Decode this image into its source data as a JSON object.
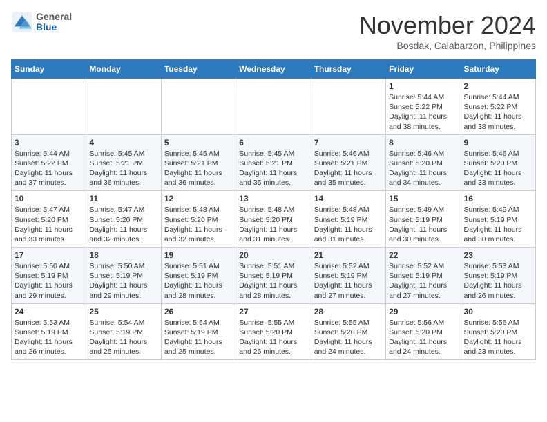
{
  "header": {
    "logo": {
      "general": "General",
      "blue": "Blue"
    },
    "title": "November 2024",
    "location": "Bosdak, Calabarzon, Philippines"
  },
  "days_of_week": [
    "Sunday",
    "Monday",
    "Tuesday",
    "Wednesday",
    "Thursday",
    "Friday",
    "Saturday"
  ],
  "weeks": [
    [
      null,
      null,
      null,
      null,
      null,
      {
        "day": 1,
        "sunrise": "5:44 AM",
        "sunset": "5:22 PM",
        "daylight": "11 hours and 38 minutes."
      },
      {
        "day": 2,
        "sunrise": "5:44 AM",
        "sunset": "5:22 PM",
        "daylight": "11 hours and 38 minutes."
      }
    ],
    [
      {
        "day": 3,
        "sunrise": "5:44 AM",
        "sunset": "5:22 PM",
        "daylight": "11 hours and 37 minutes."
      },
      {
        "day": 4,
        "sunrise": "5:45 AM",
        "sunset": "5:21 PM",
        "daylight": "11 hours and 36 minutes."
      },
      {
        "day": 5,
        "sunrise": "5:45 AM",
        "sunset": "5:21 PM",
        "daylight": "11 hours and 36 minutes."
      },
      {
        "day": 6,
        "sunrise": "5:45 AM",
        "sunset": "5:21 PM",
        "daylight": "11 hours and 35 minutes."
      },
      {
        "day": 7,
        "sunrise": "5:46 AM",
        "sunset": "5:21 PM",
        "daylight": "11 hours and 35 minutes."
      },
      {
        "day": 8,
        "sunrise": "5:46 AM",
        "sunset": "5:20 PM",
        "daylight": "11 hours and 34 minutes."
      },
      {
        "day": 9,
        "sunrise": "5:46 AM",
        "sunset": "5:20 PM",
        "daylight": "11 hours and 33 minutes."
      }
    ],
    [
      {
        "day": 10,
        "sunrise": "5:47 AM",
        "sunset": "5:20 PM",
        "daylight": "11 hours and 33 minutes."
      },
      {
        "day": 11,
        "sunrise": "5:47 AM",
        "sunset": "5:20 PM",
        "daylight": "11 hours and 32 minutes."
      },
      {
        "day": 12,
        "sunrise": "5:48 AM",
        "sunset": "5:20 PM",
        "daylight": "11 hours and 32 minutes."
      },
      {
        "day": 13,
        "sunrise": "5:48 AM",
        "sunset": "5:20 PM",
        "daylight": "11 hours and 31 minutes."
      },
      {
        "day": 14,
        "sunrise": "5:48 AM",
        "sunset": "5:19 PM",
        "daylight": "11 hours and 31 minutes."
      },
      {
        "day": 15,
        "sunrise": "5:49 AM",
        "sunset": "5:19 PM",
        "daylight": "11 hours and 30 minutes."
      },
      {
        "day": 16,
        "sunrise": "5:49 AM",
        "sunset": "5:19 PM",
        "daylight": "11 hours and 30 minutes."
      }
    ],
    [
      {
        "day": 17,
        "sunrise": "5:50 AM",
        "sunset": "5:19 PM",
        "daylight": "11 hours and 29 minutes."
      },
      {
        "day": 18,
        "sunrise": "5:50 AM",
        "sunset": "5:19 PM",
        "daylight": "11 hours and 29 minutes."
      },
      {
        "day": 19,
        "sunrise": "5:51 AM",
        "sunset": "5:19 PM",
        "daylight": "11 hours and 28 minutes."
      },
      {
        "day": 20,
        "sunrise": "5:51 AM",
        "sunset": "5:19 PM",
        "daylight": "11 hours and 28 minutes."
      },
      {
        "day": 21,
        "sunrise": "5:52 AM",
        "sunset": "5:19 PM",
        "daylight": "11 hours and 27 minutes."
      },
      {
        "day": 22,
        "sunrise": "5:52 AM",
        "sunset": "5:19 PM",
        "daylight": "11 hours and 27 minutes."
      },
      {
        "day": 23,
        "sunrise": "5:53 AM",
        "sunset": "5:19 PM",
        "daylight": "11 hours and 26 minutes."
      }
    ],
    [
      {
        "day": 24,
        "sunrise": "5:53 AM",
        "sunset": "5:19 PM",
        "daylight": "11 hours and 26 minutes."
      },
      {
        "day": 25,
        "sunrise": "5:54 AM",
        "sunset": "5:19 PM",
        "daylight": "11 hours and 25 minutes."
      },
      {
        "day": 26,
        "sunrise": "5:54 AM",
        "sunset": "5:19 PM",
        "daylight": "11 hours and 25 minutes."
      },
      {
        "day": 27,
        "sunrise": "5:55 AM",
        "sunset": "5:20 PM",
        "daylight": "11 hours and 25 minutes."
      },
      {
        "day": 28,
        "sunrise": "5:55 AM",
        "sunset": "5:20 PM",
        "daylight": "11 hours and 24 minutes."
      },
      {
        "day": 29,
        "sunrise": "5:56 AM",
        "sunset": "5:20 PM",
        "daylight": "11 hours and 24 minutes."
      },
      {
        "day": 30,
        "sunrise": "5:56 AM",
        "sunset": "5:20 PM",
        "daylight": "11 hours and 23 minutes."
      }
    ]
  ]
}
